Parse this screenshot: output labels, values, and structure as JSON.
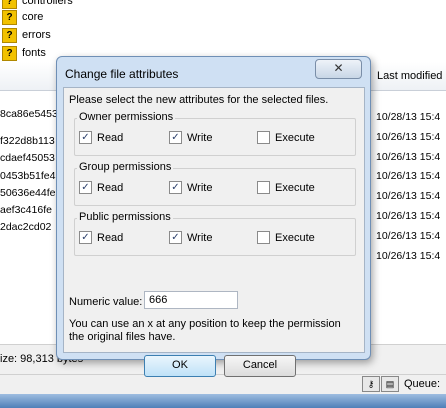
{
  "tree": {
    "items": [
      {
        "icon": "?",
        "label": "controllers"
      },
      {
        "icon": "?",
        "label": "core"
      },
      {
        "icon": "?",
        "label": "errors"
      },
      {
        "icon": "?",
        "label": "fonts"
      }
    ]
  },
  "file_list": {
    "header": {
      "last_modified": "Last modified"
    },
    "left_fragments": [
      "8ca86e5453",
      "f322d8b113",
      "cdaef45053",
      "0453b51fe4",
      "50636e44fe",
      "aef3c416fe",
      "2dac2cd02"
    ],
    "last_modified": [
      "10/28/13 15:4",
      "10/26/13 15:4",
      "10/26/13 15:4",
      "10/26/13 15:4",
      "10/26/13 15:4",
      "10/26/13 15:4",
      "10/26/13 15:4",
      "10/26/13 15:4"
    ]
  },
  "status": {
    "size_text": "ize: 98,313 bytes",
    "queue_label": "Queue:"
  },
  "dialog": {
    "title": "Change file attributes",
    "close_glyph": "✕",
    "prompt": "Please select the new attributes for the selected files.",
    "groups": [
      {
        "legend": "Owner permissions",
        "read": "Read",
        "write": "Write",
        "execute": "Execute",
        "read_checked": true,
        "write_checked": true,
        "execute_checked": false
      },
      {
        "legend": "Group permissions",
        "read": "Read",
        "write": "Write",
        "execute": "Execute",
        "read_checked": true,
        "write_checked": true,
        "execute_checked": false
      },
      {
        "legend": "Public permissions",
        "read": "Read",
        "write": "Write",
        "execute": "Execute",
        "read_checked": true,
        "write_checked": true,
        "execute_checked": false
      }
    ],
    "numeric_label": "Numeric value:",
    "numeric_value": "666",
    "info": "You can use an x at any position to keep the permission the original files have.",
    "ok": "OK",
    "cancel": "Cancel"
  },
  "check_glyph": "✓"
}
